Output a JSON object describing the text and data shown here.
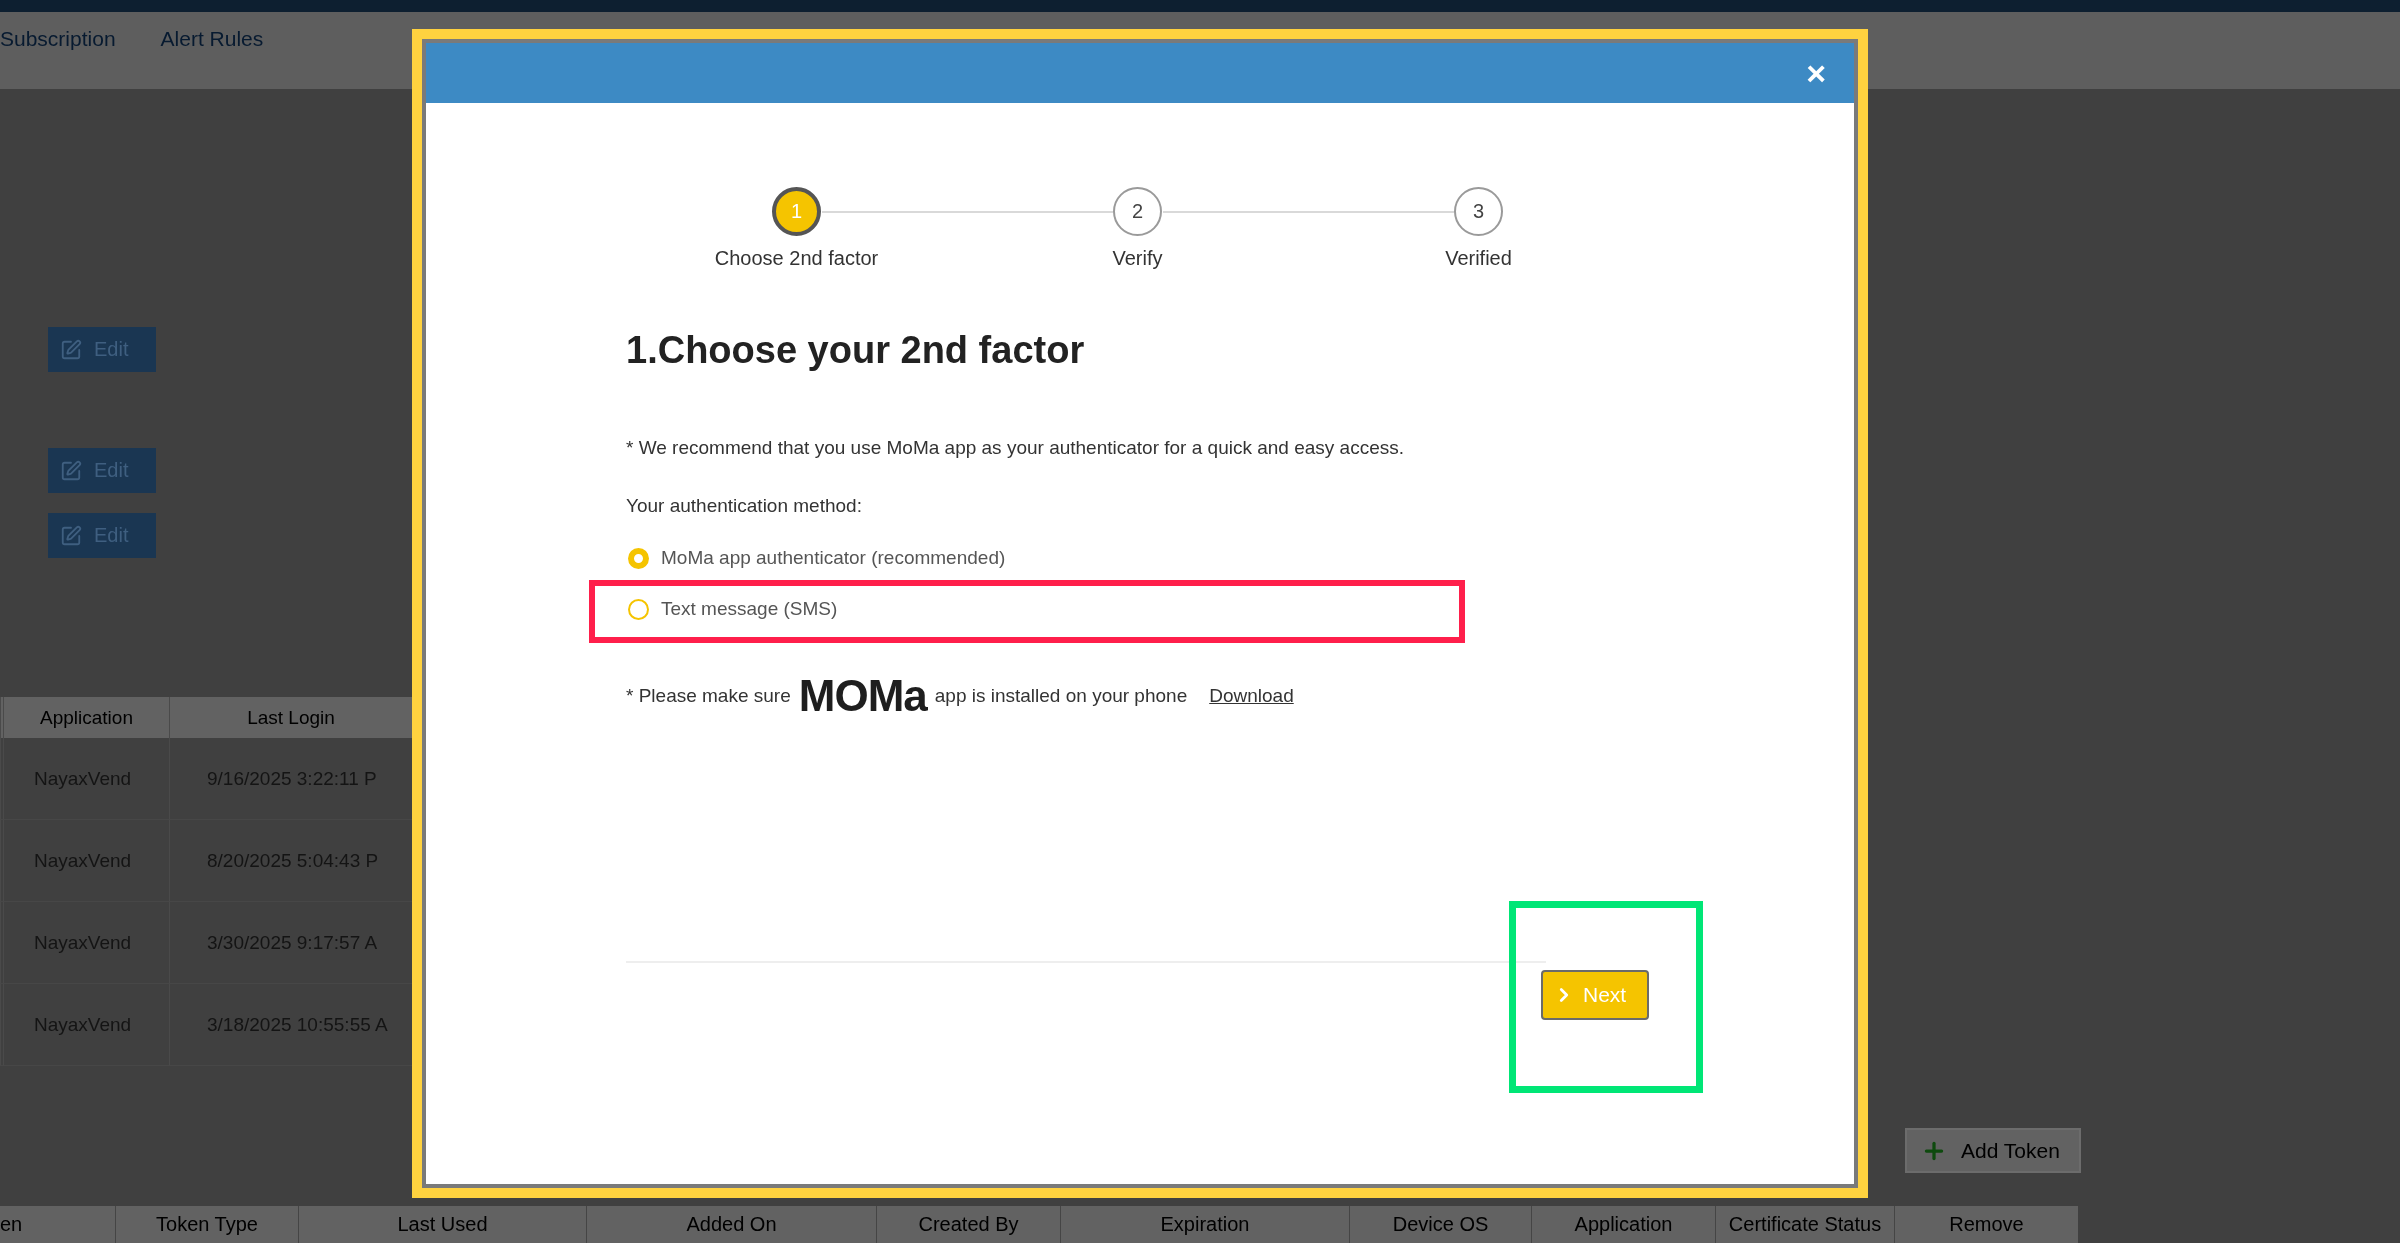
{
  "top_tabs": [
    {
      "label": "Subscription"
    },
    {
      "label": "Alert Rules"
    }
  ],
  "edit_buttons": [
    {
      "label": "Edit"
    },
    {
      "label": "Edit"
    },
    {
      "label": "Edit"
    }
  ],
  "logins_table": {
    "columns": [
      "Application",
      "Last Login"
    ],
    "rows": [
      [
        "NayaxVend",
        "9/16/2025 3:22:11 P"
      ],
      [
        "NayaxVend",
        "8/20/2025 5:04:43 P"
      ],
      [
        "NayaxVend",
        "3/30/2025 9:17:57 A"
      ],
      [
        "NayaxVend",
        "3/18/2025 10:55:55 A"
      ]
    ]
  },
  "add_token_button": {
    "label": "Add Token"
  },
  "tokens_table": {
    "columns": [
      "en",
      "Token Type",
      "Last Used",
      "Added On",
      "Created By",
      "Expiration",
      "Device OS",
      "Application",
      "Certificate Status",
      "Remove"
    ]
  },
  "modal": {
    "close": "×",
    "steps": [
      {
        "number": "1",
        "label": "Choose 2nd factor",
        "selected": true
      },
      {
        "number": "2",
        "label": "Verify",
        "selected": false
      },
      {
        "number": "3",
        "label": "Verified",
        "selected": false
      }
    ],
    "title": "1.Choose your 2nd factor",
    "recommendation": "* We recommend that you use MoMa app as your authenticator for a quick and easy access.",
    "method_label": "Your authentication method:",
    "methods": [
      {
        "label": "MoMa app authenticator (recommended)",
        "selected": true
      },
      {
        "label": "Text message (SMS)",
        "selected": false
      }
    ],
    "install_note": {
      "before": "* Please make sure",
      "logo": "MOMa",
      "after": "app is installed on your phone",
      "link": "Download"
    },
    "next_button": {
      "label": "Next"
    }
  },
  "annotations": [
    {
      "color": "#ffd23f"
    },
    {
      "color": "#ff1f4b"
    },
    {
      "color": "#00e676"
    }
  ]
}
